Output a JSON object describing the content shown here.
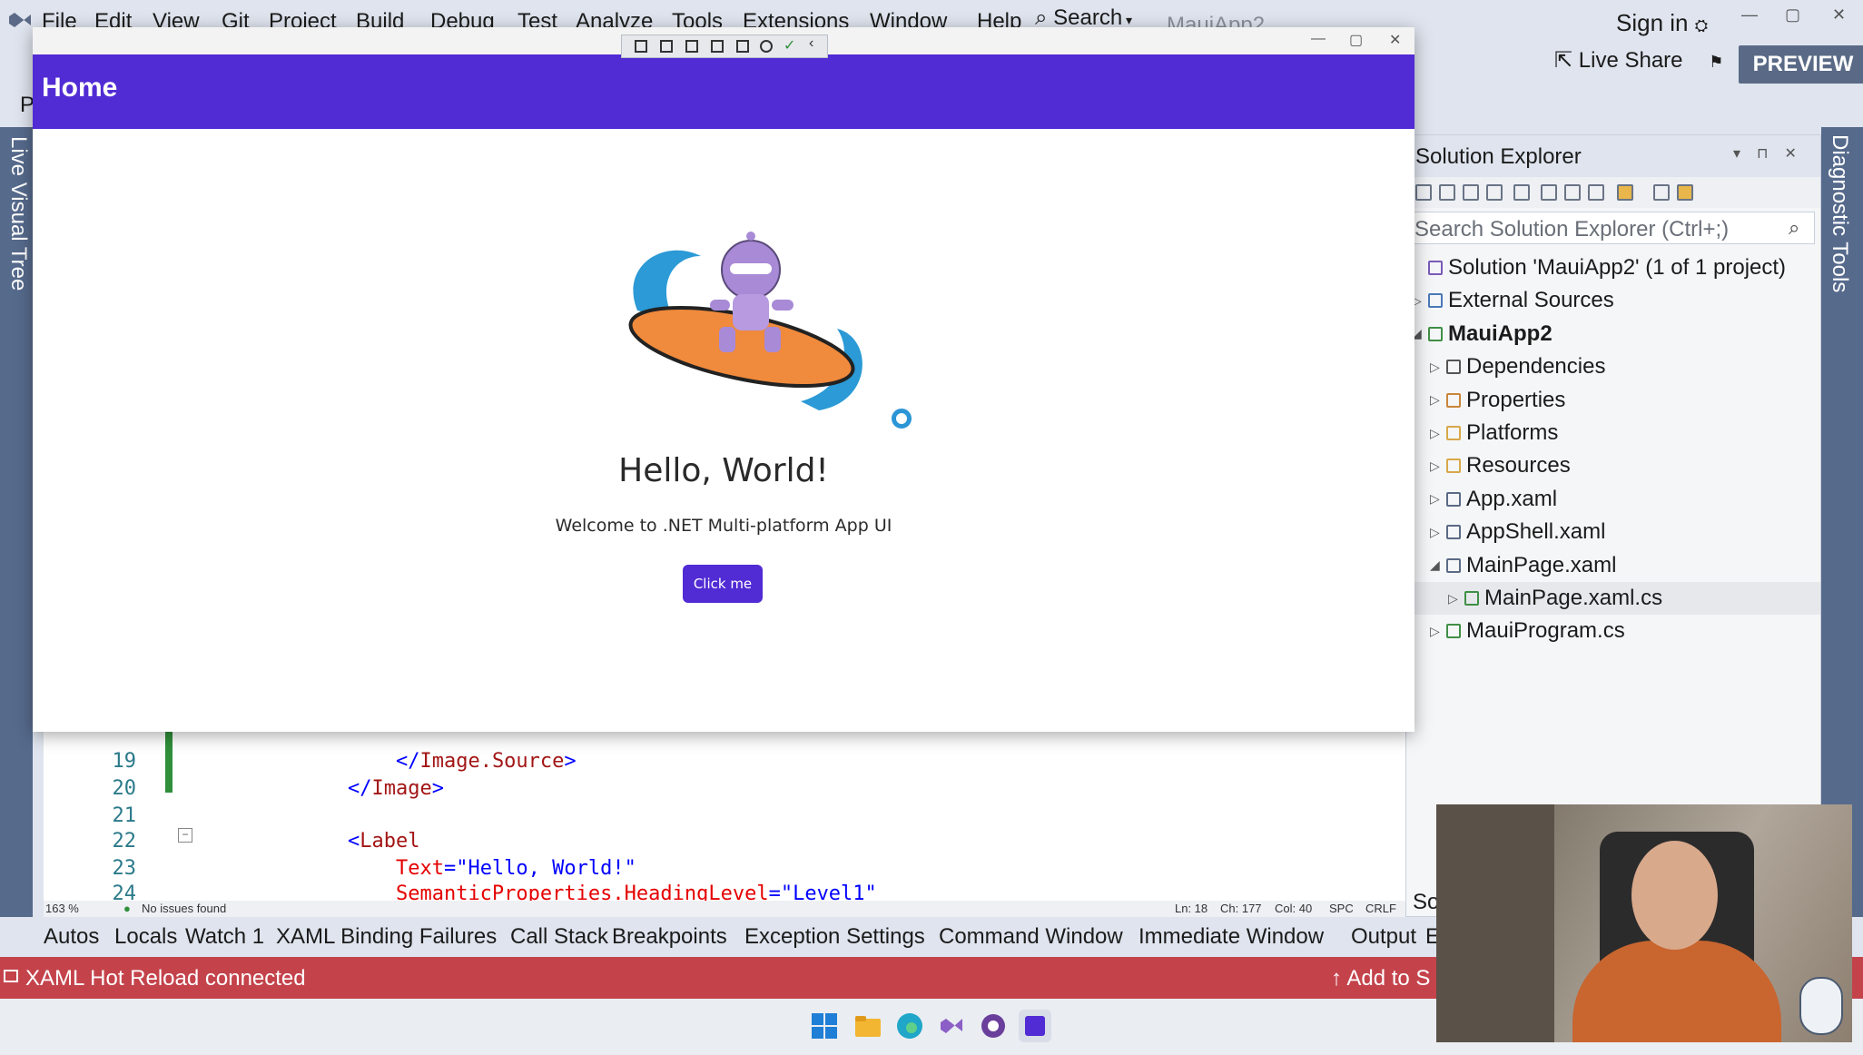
{
  "menu": [
    "File",
    "Edit",
    "View",
    "Git",
    "Project",
    "Build",
    "Debug",
    "Test",
    "Analyze",
    "Tools",
    "Extensions",
    "Window",
    "Help"
  ],
  "search_label": "Search",
  "app_name": "MauiApp2",
  "sign_in": "Sign in",
  "live_share": "Live Share",
  "preview": "PREVIEW",
  "toolbar_char": "P",
  "live_visual_tree": "Live Visual Tree",
  "diagnostic_tools": "Diagnostic Tools",
  "solution_explorer": {
    "title": "Solution Explorer",
    "search_placeholder": "Search Solution Explorer (Ctrl+;)",
    "items": [
      {
        "label": "Solution 'MauiApp2' (1 of 1 project)",
        "arrow": "",
        "icon": "solution-icon",
        "color": "#7a5ab8"
      },
      {
        "label": "External Sources",
        "arrow": "▷",
        "icon": "external-sources-icon",
        "color": "#4a78b8"
      },
      {
        "label": "MauiApp2",
        "arrow": "◢",
        "icon": "project-icon",
        "color": "#3f8f46",
        "bold": true
      },
      {
        "label": "Dependencies",
        "arrow": "▷",
        "icon": "dependencies-icon",
        "color": "#555"
      },
      {
        "label": "Properties",
        "arrow": "▷",
        "icon": "properties-icon",
        "color": "#c9863a"
      },
      {
        "label": "Platforms",
        "arrow": "▷",
        "icon": "folder-icon",
        "color": "#d8a84a"
      },
      {
        "label": "Resources",
        "arrow": "▷",
        "icon": "folder-icon",
        "color": "#d8a84a"
      },
      {
        "label": "App.xaml",
        "arrow": "▷",
        "icon": "xaml-file-icon",
        "color": "#5a6a86"
      },
      {
        "label": "AppShell.xaml",
        "arrow": "▷",
        "icon": "xaml-file-icon",
        "color": "#5a6a86"
      },
      {
        "label": "MainPage.xaml",
        "arrow": "◢",
        "icon": "xaml-file-icon",
        "color": "#5a6a86"
      },
      {
        "label": "MainPage.xaml.cs",
        "arrow": "▷",
        "icon": "csharp-file-icon",
        "color": "#3f8f46",
        "selected": true
      },
      {
        "label": "MauiProgram.cs",
        "arrow": "▷",
        "icon": "csharp-file-icon",
        "color": "#3f8f46"
      }
    ]
  },
  "editor": {
    "lines": [
      {
        "num": "19",
        "indent": "        ",
        "parts": [
          [
            "</",
            "brk"
          ],
          [
            "Image.Source",
            "tag"
          ],
          [
            ">",
            "brk"
          ]
        ]
      },
      {
        "num": "20",
        "indent": "    ",
        "parts": [
          [
            "</",
            "brk"
          ],
          [
            "Image",
            "tag"
          ],
          [
            ">",
            "brk"
          ]
        ]
      },
      {
        "num": "21",
        "indent": "",
        "parts": []
      },
      {
        "num": "22",
        "indent": "    ",
        "parts": [
          [
            "<",
            "brk"
          ],
          [
            "Label",
            "tag"
          ]
        ]
      },
      {
        "num": "23",
        "indent": "        ",
        "parts": [
          [
            "Text",
            "attr"
          ],
          [
            "=",
            "brk"
          ],
          [
            "\"Hello, World!\"",
            "str"
          ]
        ]
      },
      {
        "num": "24",
        "indent": "        ",
        "parts": [
          [
            "SemanticProperties.HeadingLevel",
            "attr"
          ],
          [
            "=",
            "brk"
          ],
          [
            "\"Level1\"",
            "str"
          ]
        ]
      }
    ],
    "zoom": "163 %",
    "issues": "No issues found",
    "ln": "Ln: 18",
    "ch": "Ch: 177",
    "col": "Col: 40",
    "spc": "SPC",
    "crlf": "CRLF"
  },
  "tool_tabs": [
    "Autos",
    "Locals",
    "Watch 1",
    "XAML Binding Failures",
    "Call Stack",
    "Breakpoints",
    "Exception Settings",
    "Command Window",
    "Immediate Window",
    "Output",
    "E"
  ],
  "status": {
    "text": "XAML Hot Reload connected",
    "add_to": "↑ Add to S"
  },
  "so_text": "So",
  "app_window": {
    "title": "Home",
    "hello": "Hello, World!",
    "welcome": "Welcome to .NET Multi-platform App UI",
    "button": "Click me"
  },
  "colors": {
    "maui_purple": "#512bd4",
    "status_red": "#c4434b",
    "ide_blue": "#566a8c"
  }
}
